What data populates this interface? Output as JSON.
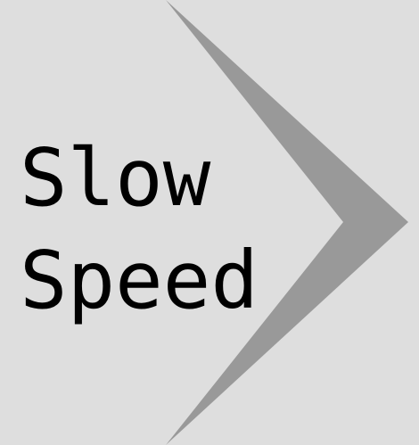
{
  "button": {
    "line1": "Slow",
    "line2": "Speed",
    "icon": "chevron-right-icon"
  },
  "colors": {
    "background": "#dedede",
    "chevron": "#999999",
    "text": "#000000"
  }
}
